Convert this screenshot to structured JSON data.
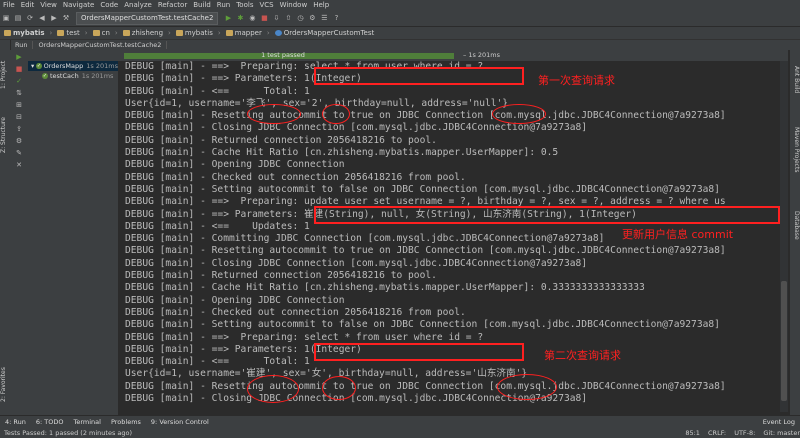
{
  "menu": [
    "File",
    "Edit",
    "View",
    "Navigate",
    "Code",
    "Analyze",
    "Refactor",
    "Build",
    "Run",
    "Tools",
    "VCS",
    "Window",
    "Help"
  ],
  "toolbar": {
    "run_config": "OrdersMapperCustomTest.testCache2"
  },
  "breadcrumb": [
    "mybatis",
    "test",
    "cn",
    "zhisheng",
    "mybatis",
    "mapper",
    "OrdersMapperCustomTest"
  ],
  "run_tab": "Run",
  "run_tab_file": "OrdersMapperCustomTest.testCache2",
  "left_labels": {
    "project": "1: Project",
    "structure": "Z: Structure",
    "favorites": "2: Favorites"
  },
  "right_labels": {
    "ant": "Ant Build",
    "maven": "Maven Projects",
    "database": "Database"
  },
  "tree": [
    {
      "name": "OrdersMapp",
      "time": "1s 201ms"
    },
    {
      "name": "testCach",
      "time": "1s 201ms"
    }
  ],
  "test_status": {
    "text": "1 test passed",
    "time": "– 1s 201ms",
    "progress": 1.0
  },
  "console_lines": [
    "DEBUG [main] - ==>  Preparing: select * from user where id = ?",
    "DEBUG [main] - ==> Parameters: 1(Integer)",
    "DEBUG [main] - <==      Total: 1",
    "User{id=1, username='李飞', sex='2', birthday=null, address='null'}",
    "DEBUG [main] - Resetting autocommit to true on JDBC Connection [com.mysql.jdbc.JDBC4Connection@7a9273a8]",
    "DEBUG [main] - Closing JDBC Connection [com.mysql.jdbc.JDBC4Connection@7a9273a8]",
    "DEBUG [main] - Returned connection 2056418216 to pool.",
    "DEBUG [main] - Cache Hit Ratio [cn.zhisheng.mybatis.mapper.UserMapper]: 0.5",
    "DEBUG [main] - Opening JDBC Connection",
    "DEBUG [main] - Checked out connection 2056418216 from pool.",
    "DEBUG [main] - Setting autocommit to false on JDBC Connection [com.mysql.jdbc.JDBC4Connection@7a9273a8]",
    "DEBUG [main] - ==>  Preparing: update user set username = ?, birthday = ?, sex = ?, address = ? where us",
    "DEBUG [main] - ==> Parameters: 崔建(String), null, 女(String), 山东济南(String), 1(Integer)",
    "DEBUG [main] - <==    Updates: 1",
    "DEBUG [main] - Committing JDBC Connection [com.mysql.jdbc.JDBC4Connection@7a9273a8]",
    "DEBUG [main] - Resetting autocommit to true on JDBC Connection [com.mysql.jdbc.JDBC4Connection@7a9273a8]",
    "DEBUG [main] - Closing JDBC Connection [com.mysql.jdbc.JDBC4Connection@7a9273a8]",
    "DEBUG [main] - Returned connection 2056418216 to pool.",
    "DEBUG [main] - Cache Hit Ratio [cn.zhisheng.mybatis.mapper.UserMapper]: 0.3333333333333333",
    "DEBUG [main] - Opening JDBC Connection",
    "DEBUG [main] - Checked out connection 2056418216 from pool.",
    "DEBUG [main] - Setting autocommit to false on JDBC Connection [com.mysql.jdbc.JDBC4Connection@7a9273a8]",
    "DEBUG [main] - ==>  Preparing: select * from user where id = ?",
    "DEBUG [main] - ==> Parameters: 1(Integer)",
    "DEBUG [main] - <==      Total: 1",
    "User{id=1, username='崔建', sex='女', birthday=null, address='山东济南'}",
    "DEBUG [main] - Resetting autocommit to true on JDBC Connection [com.mysql.jdbc.JDBC4Connection@7a9273a8]",
    "DEBUG [main] - Closing JDBC Connection [com.mysql.jdbc.JDBC4Connection@7a9273a8]"
  ],
  "annotations": {
    "first": "第一次查询请求",
    "update": "更新用户信息 commit",
    "second": "第二次查询请求"
  },
  "bottom_tabs": [
    "4: Run",
    "6: TODO",
    "Terminal",
    "Problems",
    "9: Version Control"
  ],
  "event_log": "Event Log",
  "status": {
    "left": "Tests Passed: 1 passed (2 minutes ago)",
    "pos": "85:1",
    "crlf": "CRLF:",
    "enc": "UTF-8:",
    "git": "Git: master"
  },
  "colors": {
    "accent_red": "#ff2020",
    "bg": "#2b2b2b",
    "panel": "#3c3f41",
    "pass_green": "#4f7e3a"
  }
}
